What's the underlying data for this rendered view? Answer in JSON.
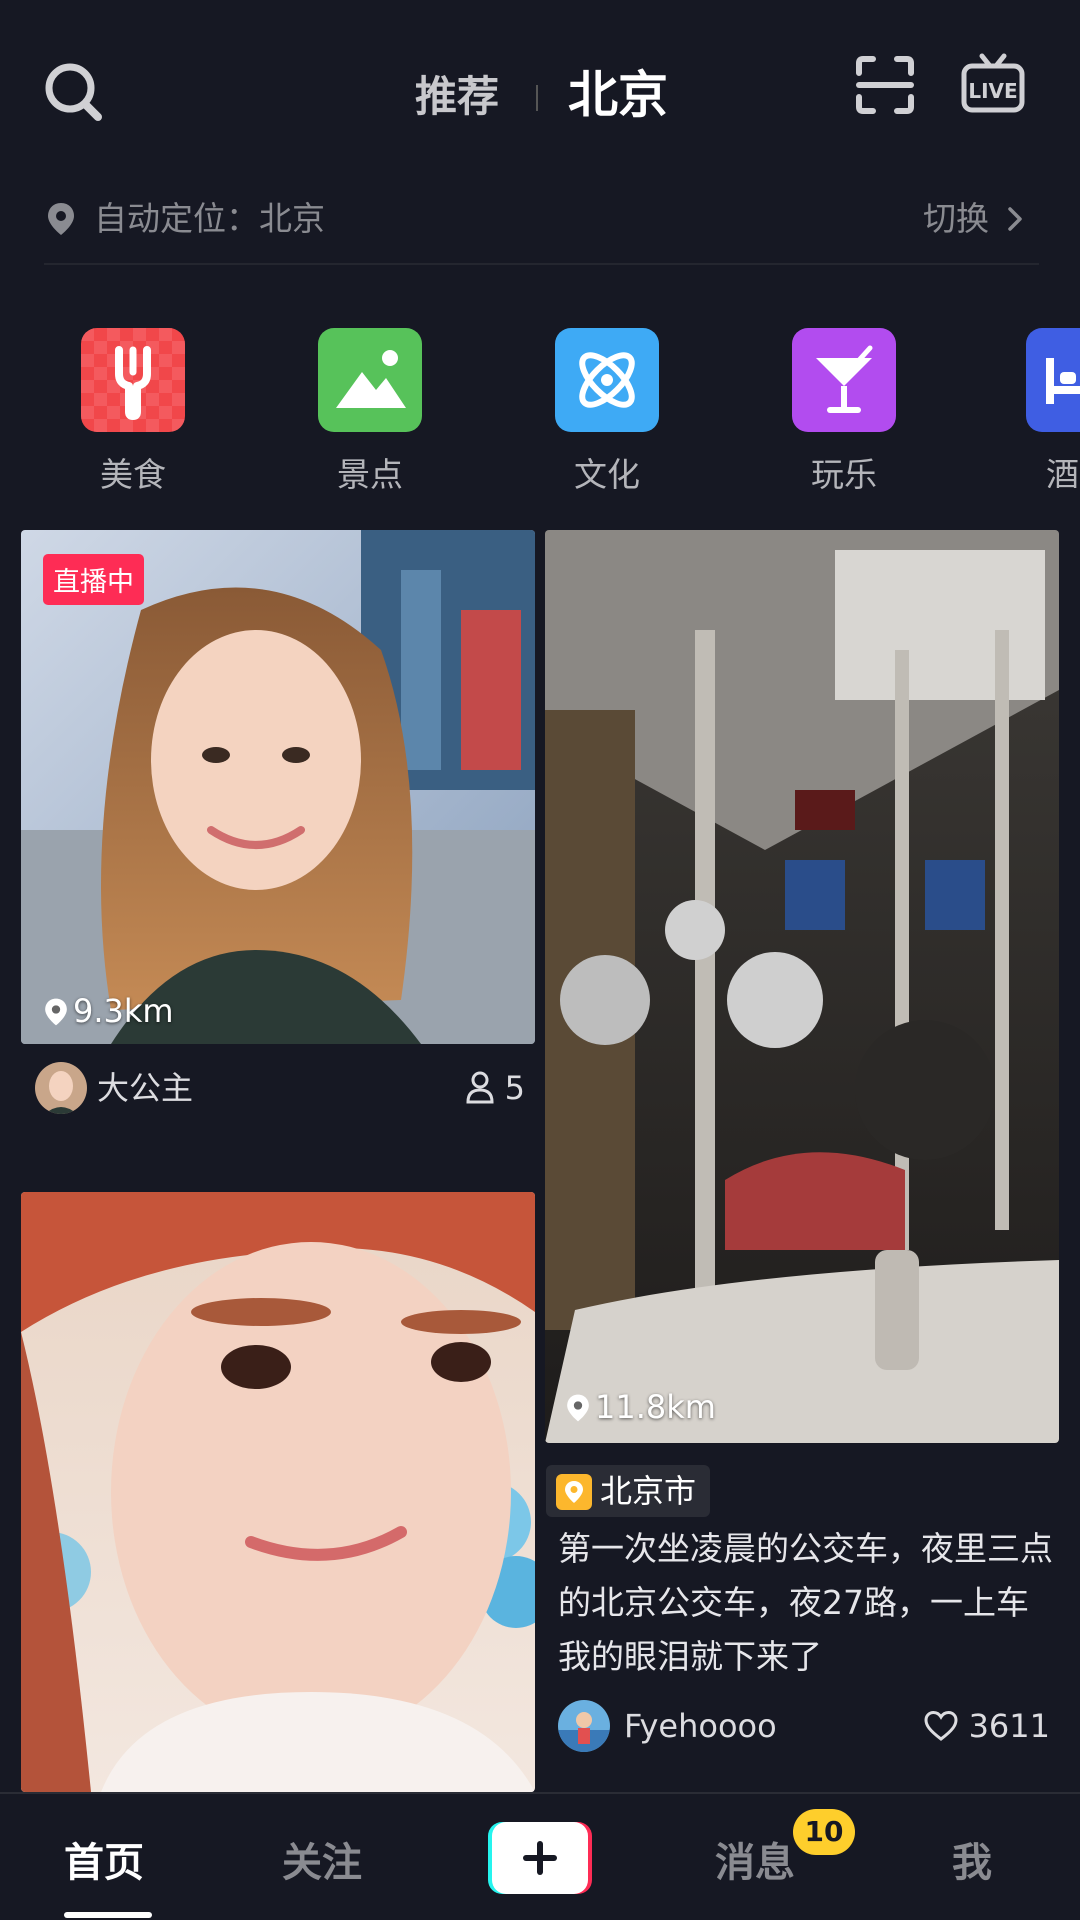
{
  "header": {
    "tab_recommend": "推荐",
    "tab_city": "北京"
  },
  "location": {
    "label": "自动定位：北京",
    "switch_label": "切换"
  },
  "categories": [
    {
      "label": "美食",
      "icon": "fork-icon",
      "color": "#f1474a"
    },
    {
      "label": "景点",
      "icon": "mountain-icon",
      "color": "#57c25a"
    },
    {
      "label": "文化",
      "icon": "atom-icon",
      "color": "#3eaaf5"
    },
    {
      "label": "玩乐",
      "icon": "cocktail-icon",
      "color": "#b24cef"
    },
    {
      "label": "酒",
      "icon": "bed-icon",
      "color": "#3f5ee3"
    }
  ],
  "feed": {
    "card1": {
      "badge": "直播中",
      "distance": "9.3km",
      "user": "大公主",
      "viewers": "5"
    },
    "card2": {
      "distance": "11.8km",
      "city_tag": "北京市",
      "caption": "第一次坐凌晨的公交车，夜里三点的北京公交车，夜27路，一上车我的眼泪就下来了",
      "user": "Fyehoooo",
      "likes": "3611"
    }
  },
  "nav": {
    "home": "首页",
    "follow": "关注",
    "messages": "消息",
    "messages_badge": "10",
    "me": "我"
  }
}
